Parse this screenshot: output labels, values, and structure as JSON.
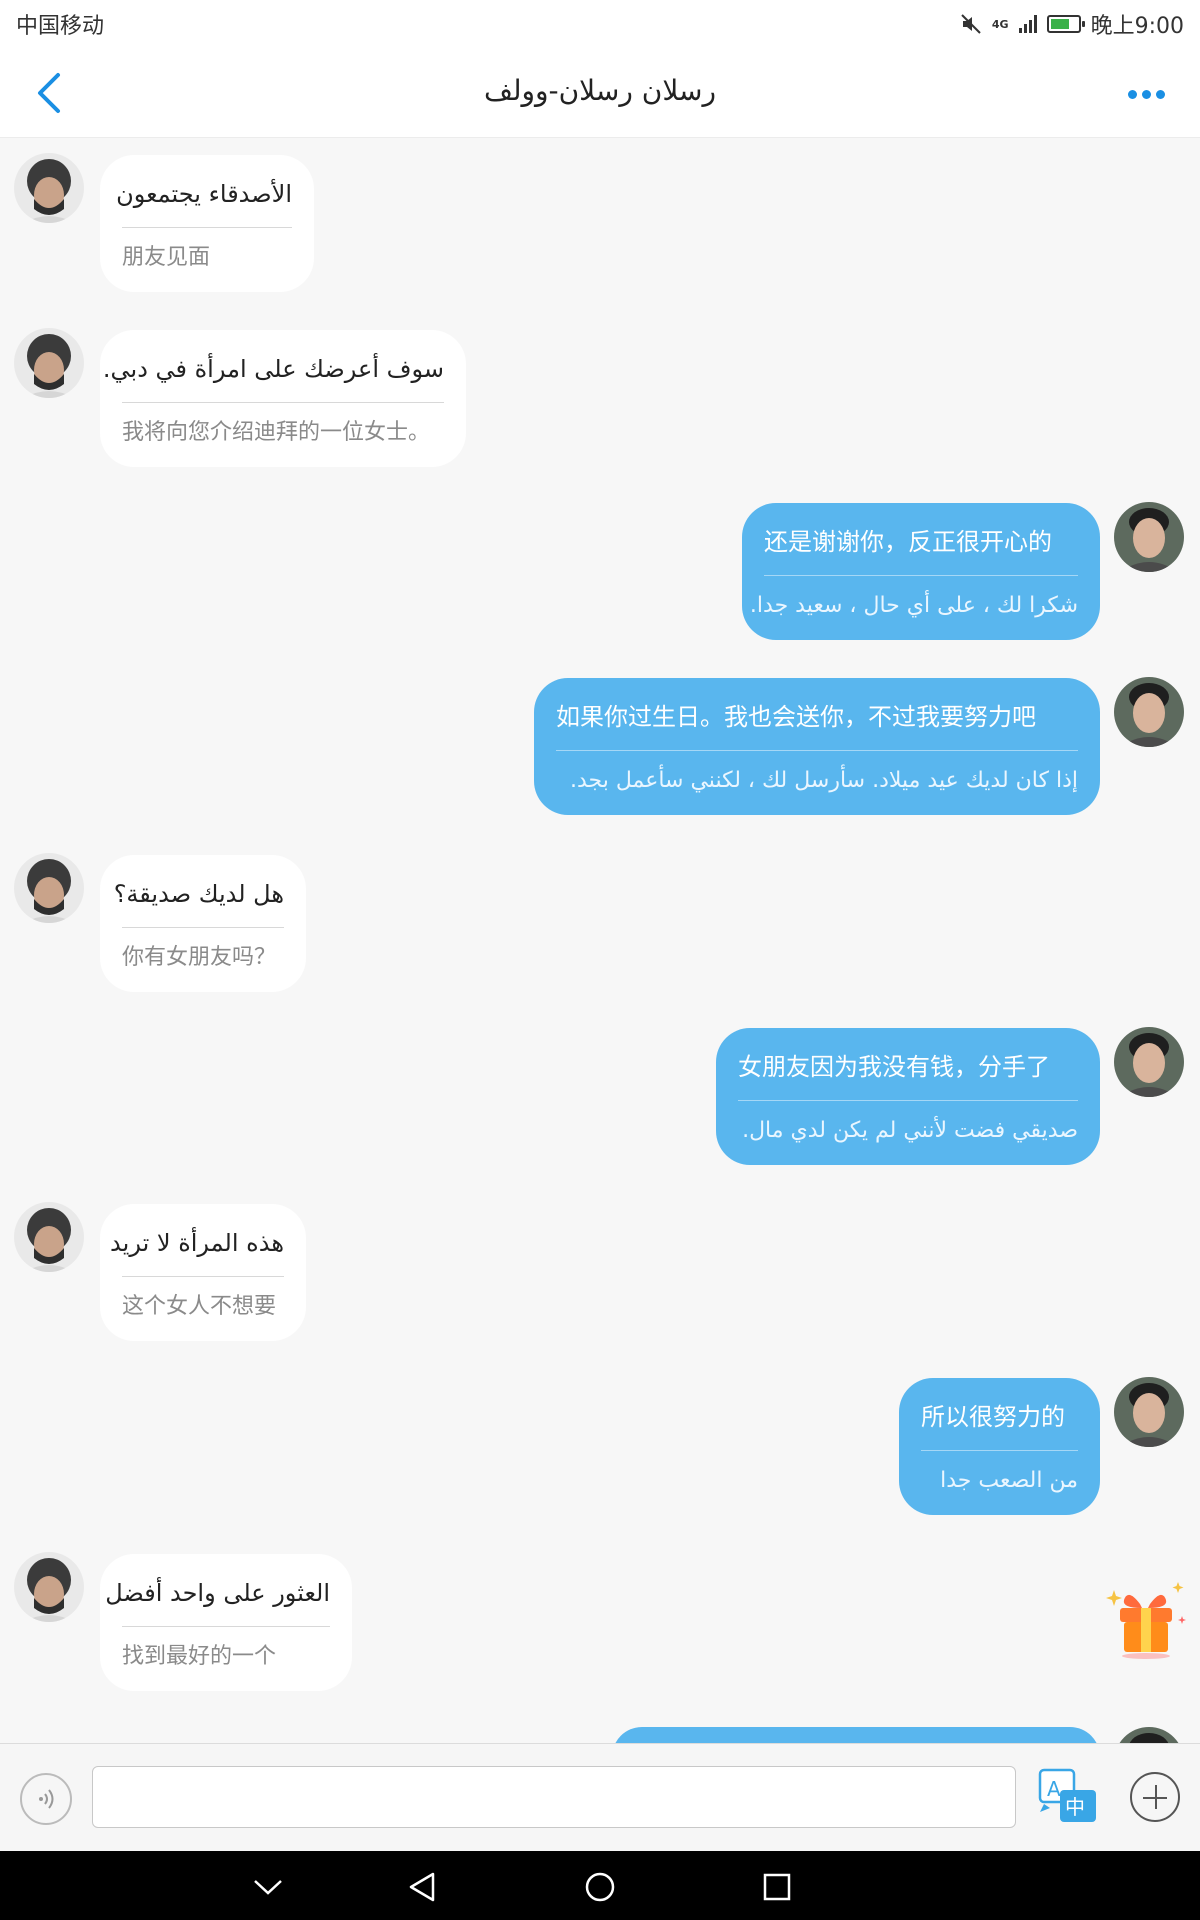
{
  "status_bar": {
    "carrier": "中国移动",
    "network": "4G",
    "time": "晚上9:00"
  },
  "header": {
    "title": "رسلان رسلان-وولف"
  },
  "messages": [
    {
      "direction": "in",
      "original": "الأصدقاء يجتمعون",
      "translation": "朋友见面"
    },
    {
      "direction": "in",
      "original": "سوف أعرضك على امرأة في دبي.",
      "translation": "我将向您介绍迪拜的一位女士。"
    },
    {
      "direction": "out",
      "original": "还是谢谢你，反正很开心的",
      "translation": "شكرا لك ، على أي حال ، سعيد جدا."
    },
    {
      "direction": "out",
      "original": "如果你过生日。我也会送你，不过我要努力吧",
      "translation": "إذا كان لديك عيد ميلاد. سأرسل لك ، لكنني سأعمل بجد."
    },
    {
      "direction": "in",
      "original": "هل لديك صديقة؟",
      "translation": "你有女朋友吗？"
    },
    {
      "direction": "out",
      "original": "女朋友因为我没有钱，分手了",
      "translation": "صديقي فضت لأنني لم يكن لدي مال."
    },
    {
      "direction": "in",
      "original": "هذه المرأة لا تريد",
      "translation": "这个女人不想要"
    },
    {
      "direction": "out",
      "original": "所以很努力的",
      "translation": "من الصعب جدا"
    },
    {
      "direction": "in",
      "original": "العثور على واحد أفضل",
      "translation": "找到最好的一个"
    }
  ],
  "input_bar": {
    "message_value": "",
    "translate_icon": "translate-a-zhong-icon"
  },
  "colors": {
    "accent": "#1a8fe3",
    "outgoing_bubble": "#59b6ee",
    "incoming_bubble": "#ffffff",
    "background": "#f7f7f7"
  }
}
